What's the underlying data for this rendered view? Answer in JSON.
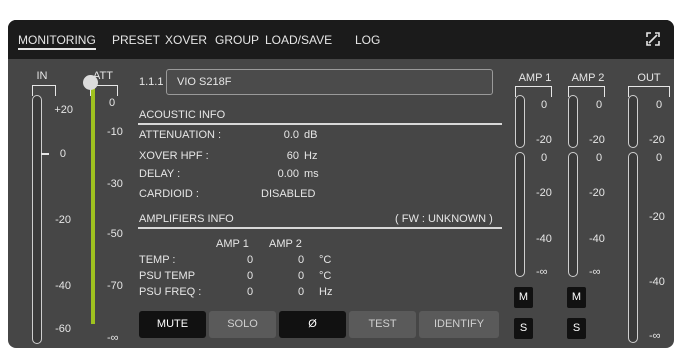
{
  "tabs": [
    "MONITORING",
    "PRESET",
    "XOVER",
    "GROUP",
    "LOAD/SAVE",
    "LOG"
  ],
  "icons": {
    "expand": "expand-icon"
  },
  "in_meter": {
    "label": "IN",
    "scale": [
      "+20",
      "0",
      "-20",
      "-40",
      "-60"
    ]
  },
  "att_meter": {
    "label": "ATT",
    "scale": [
      "0",
      "-10",
      "-30",
      "-50",
      "-70",
      "-∞"
    ],
    "accent": "#9fc21f"
  },
  "device": {
    "id": "1.1.1",
    "name": "VIO S218F"
  },
  "acoustic": {
    "title": "ACOUSTIC INFO",
    "attenuation_label": "ATTENUATION :",
    "attenuation_value": "0.0",
    "attenuation_unit": "dB",
    "xover_label": "XOVER HPF :",
    "xover_value": "60",
    "xover_unit": "Hz",
    "delay_label": "DELAY :",
    "delay_value": "0.00",
    "delay_unit": "ms",
    "cardioid_label": "CARDIOID :",
    "cardioid_value": "DISABLED"
  },
  "amplifiers": {
    "title": "AMPLIFIERS INFO",
    "fw": "( FW : UNKNOWN )",
    "col1": "AMP 1",
    "col2": "AMP 2",
    "temp_label": "TEMP :",
    "temp_1": "0",
    "temp_2": "0",
    "temp_unit": "°C",
    "psutemp_label": "PSU TEMP",
    "psutemp_1": "0",
    "psutemp_2": "0",
    "psutemp_unit": "°C",
    "psufreq_label": "PSU FREQ :",
    "psufreq_1": "0",
    "psufreq_2": "0",
    "psufreq_unit": "Hz"
  },
  "buttons": {
    "mute": "MUTE",
    "solo": "SOLO",
    "phase": "Ø",
    "test": "TEST",
    "identify": "IDENTIFY"
  },
  "amp1": {
    "label": "AMP 1",
    "top_scale": [
      "0",
      "-20"
    ],
    "bottom_scale": [
      "0",
      "-20",
      "-40",
      "-∞"
    ],
    "mute": "M",
    "solo": "S"
  },
  "amp2": {
    "label": "AMP 2",
    "top_scale": [
      "0",
      "-20"
    ],
    "bottom_scale": [
      "0",
      "-20",
      "-40",
      "-∞"
    ],
    "mute": "M",
    "solo": "S"
  },
  "out_meter": {
    "label": "OUT",
    "scale": [
      "0",
      "-20",
      "0",
      "-20",
      "-40",
      "-∞"
    ]
  }
}
